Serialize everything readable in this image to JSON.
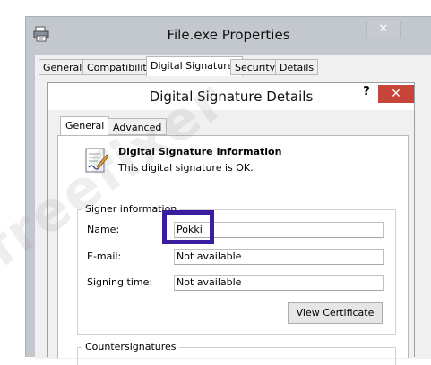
{
  "outer_window": {
    "title": "File.exe Properties",
    "close_glyph": "✕",
    "tabs": [
      {
        "label": "General",
        "active": false
      },
      {
        "label": "Compatibility",
        "active": false
      },
      {
        "label": "Digital Signatures",
        "active": true
      },
      {
        "label": "Security",
        "active": false
      },
      {
        "label": "Details",
        "active": false
      }
    ]
  },
  "dialog": {
    "title": "Digital Signature Details",
    "help_glyph": "?",
    "close_glyph": "✕",
    "tabs": [
      {
        "label": "General",
        "active": true
      },
      {
        "label": "Advanced",
        "active": false
      }
    ],
    "info_title": "Digital Signature Information",
    "info_status": "This digital signature is OK.",
    "signer_group_label": "Signer information",
    "name_label": "Name:",
    "name_value": "Pokki",
    "email_label": "E-mail:",
    "email_value": "Not available",
    "signing_time_label": "Signing time:",
    "signing_time_value": "Not available",
    "view_certificate_label": "View Certificate",
    "countersig_group_label": "Countersignatures"
  },
  "watermark": "freefixer",
  "colors": {
    "highlight": "#3a1d9f",
    "close_red": "#c7443a"
  },
  "icons": {
    "outer_app": "printer-icon",
    "certificate": "certificate-icon"
  }
}
